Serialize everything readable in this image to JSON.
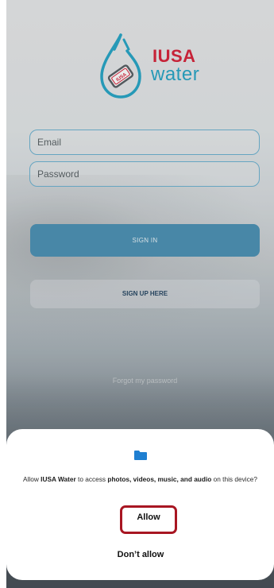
{
  "brand": {
    "line1": "IUSA",
    "line2": "water",
    "badge": "IUSA"
  },
  "login": {
    "email_placeholder": "Email",
    "password_placeholder": "Password",
    "signin_label": "SIGN IN",
    "signup_label": "SIGN UP HERE",
    "forgot_label": "Forgot my password"
  },
  "permission_dialog": {
    "icon": "folder-icon",
    "prompt_prefix": "Allow ",
    "app_name": "IUSA Water",
    "prompt_middle": " to access ",
    "media_types": "photos, videos, music, and audio",
    "prompt_suffix": " on this device?",
    "allow_label": "Allow",
    "deny_label": "Don’t allow"
  },
  "colors": {
    "accent_blue": "#4f93b6",
    "brand_red": "#d7263d",
    "brand_cyan": "#2aa6c7",
    "highlight_red": "#a81622",
    "folder_blue": "#1f7fd1"
  }
}
